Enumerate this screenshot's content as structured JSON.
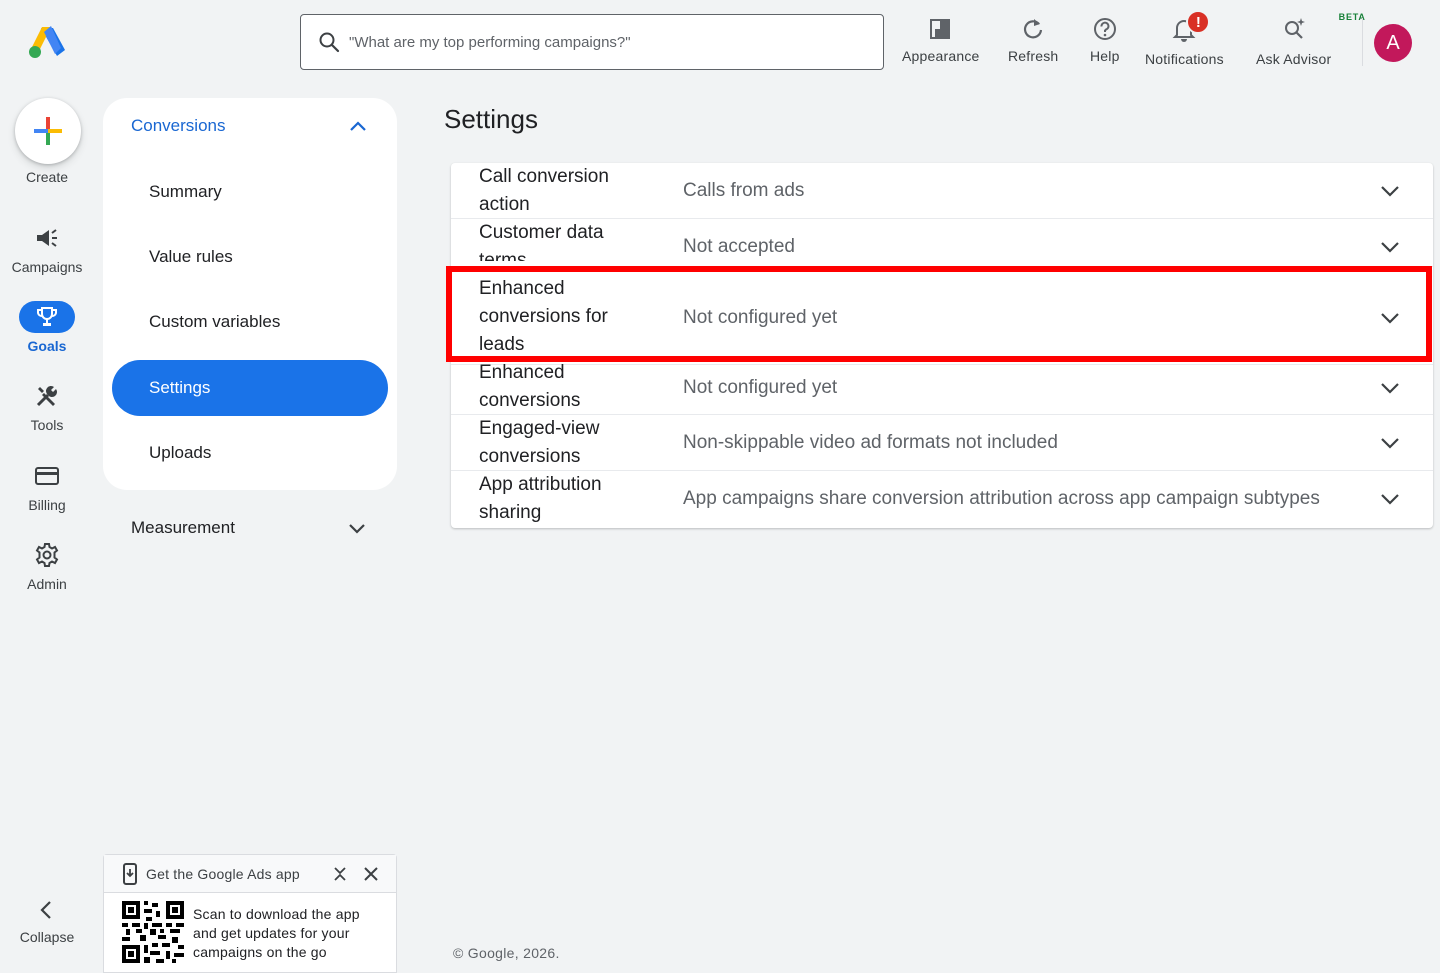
{
  "header": {
    "search_placeholder": "\"What are my top performing campaigns?\"",
    "tools": [
      {
        "label": "Appearance",
        "icon": "appearance-icon"
      },
      {
        "label": "Refresh",
        "icon": "refresh-icon"
      },
      {
        "label": "Help",
        "icon": "help-icon"
      },
      {
        "label": "Notifications",
        "icon": "bell-icon",
        "badge": "!"
      },
      {
        "label": "Ask Advisor",
        "icon": "advisor-icon",
        "tag": "BETA"
      }
    ],
    "avatar_letter": "A"
  },
  "rail": {
    "create_label": "Create",
    "items": [
      {
        "label": "Campaigns",
        "icon": "megaphone-icon"
      },
      {
        "label": "Goals",
        "icon": "trophy-icon",
        "active": true
      },
      {
        "label": "Tools",
        "icon": "tools-icon"
      },
      {
        "label": "Billing",
        "icon": "credit-card-icon"
      },
      {
        "label": "Admin",
        "icon": "gear-icon"
      }
    ],
    "collapse_label": "Collapse"
  },
  "sidenav": {
    "section": "Conversions",
    "items": [
      "Summary",
      "Value rules",
      "Custom variables",
      "Settings",
      "Uploads"
    ],
    "active": "Settings",
    "measurement": "Measurement"
  },
  "main": {
    "title": "Settings",
    "rows": [
      {
        "name": "Call conversion action",
        "value": "Calls from ads"
      },
      {
        "name": "Customer data terms",
        "value": "Not accepted"
      },
      {
        "name": "Enhanced conversions for leads",
        "value": "Not configured yet"
      },
      {
        "name": "Enhanced conversions",
        "value": "Not configured yet"
      },
      {
        "name": "Engaged-view conversions",
        "value": "Non-skippable video ad formats not included"
      },
      {
        "name": "App attribution sharing",
        "value": "App campaigns share conversion attribution across app campaign subtypes"
      }
    ],
    "highlight_color": "#ff0000"
  },
  "promo": {
    "title": "Get the Google Ads app",
    "text": "Scan to download the app and get updates for your campaigns on the go"
  },
  "footer": "© Google, 2026.",
  "colors": {
    "accent": "#1a73e8",
    "avatar": "#c2185b",
    "alert": "#d93025"
  }
}
